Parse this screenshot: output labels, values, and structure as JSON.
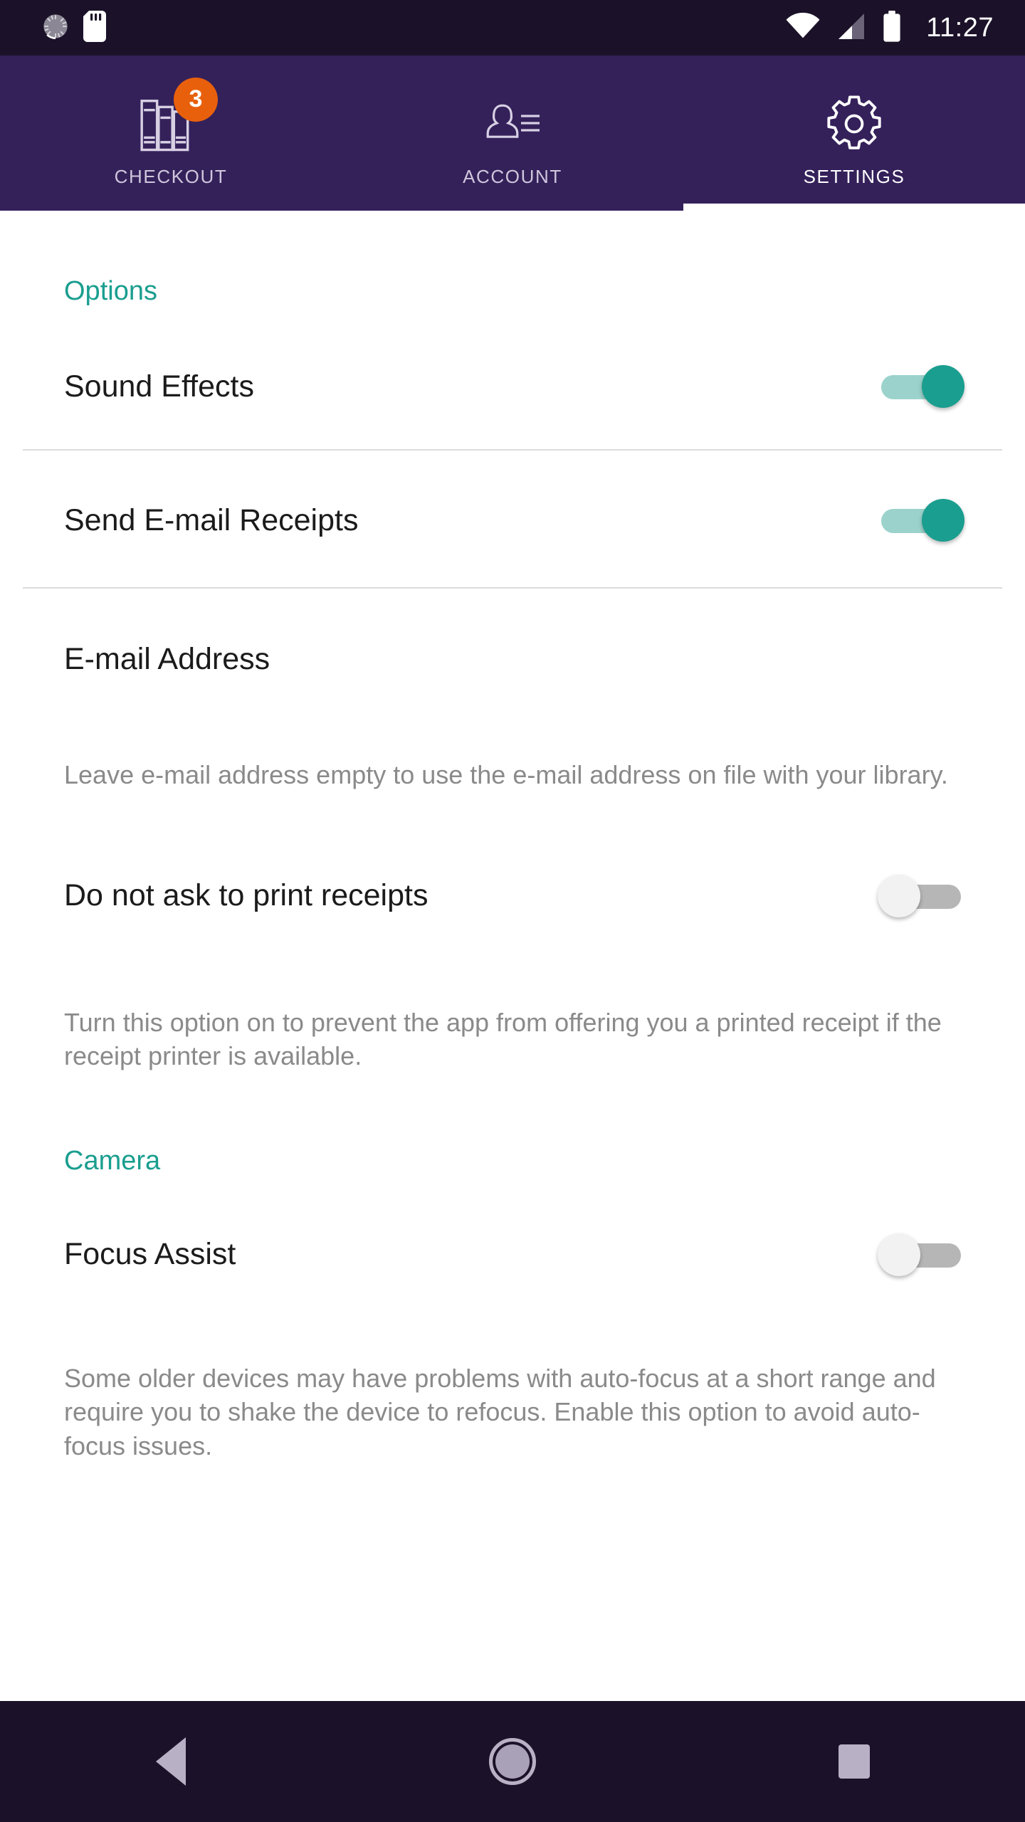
{
  "statusbar": {
    "clock": "11:27",
    "icons": [
      "sync-progress-icon",
      "sd-card-icon",
      "wifi-icon",
      "cellular-signal-icon",
      "battery-icon"
    ]
  },
  "tabbar": {
    "tabs": [
      {
        "label": "CHECKOUT",
        "icon": "books-icon",
        "badge": "3",
        "active": false
      },
      {
        "label": "ACCOUNT",
        "icon": "contact-card-icon",
        "badge": "",
        "active": false
      },
      {
        "label": "SETTINGS",
        "icon": "gear-icon",
        "badge": "",
        "active": true
      }
    ]
  },
  "settings": {
    "options_section": {
      "title": "Options",
      "sound_effects": {
        "label": "Sound Effects",
        "state": "on"
      },
      "send_email_receipts": {
        "label": "Send E-mail Receipts",
        "state": "on"
      },
      "email_address": {
        "label": "E-mail Address",
        "value": "",
        "placeholder": "E-mail Address",
        "helper": "Leave e-mail address empty to use the e-mail address on file with your library."
      },
      "do_not_ask_print": {
        "label": "Do not ask to print receipts",
        "state": "off",
        "helper": "Turn this option on to prevent the app from offering you a printed receipt if the receipt printer is available."
      }
    },
    "camera_section": {
      "title": "Camera",
      "focus_assist": {
        "label": "Focus Assist",
        "state": "off",
        "helper": "Some older devices may have problems with auto-focus at a short range and require you to shake the device to refocus. Enable this option to avoid auto-focus issues."
      }
    }
  },
  "navbar": {
    "back": "back-button",
    "home": "home-button",
    "recents": "recents-button"
  },
  "colors": {
    "accent_teal": "#1a9e8f",
    "header_purple": "#34215a",
    "statusbar_dark": "#1b1229",
    "badge_orange": "#e8600c"
  }
}
